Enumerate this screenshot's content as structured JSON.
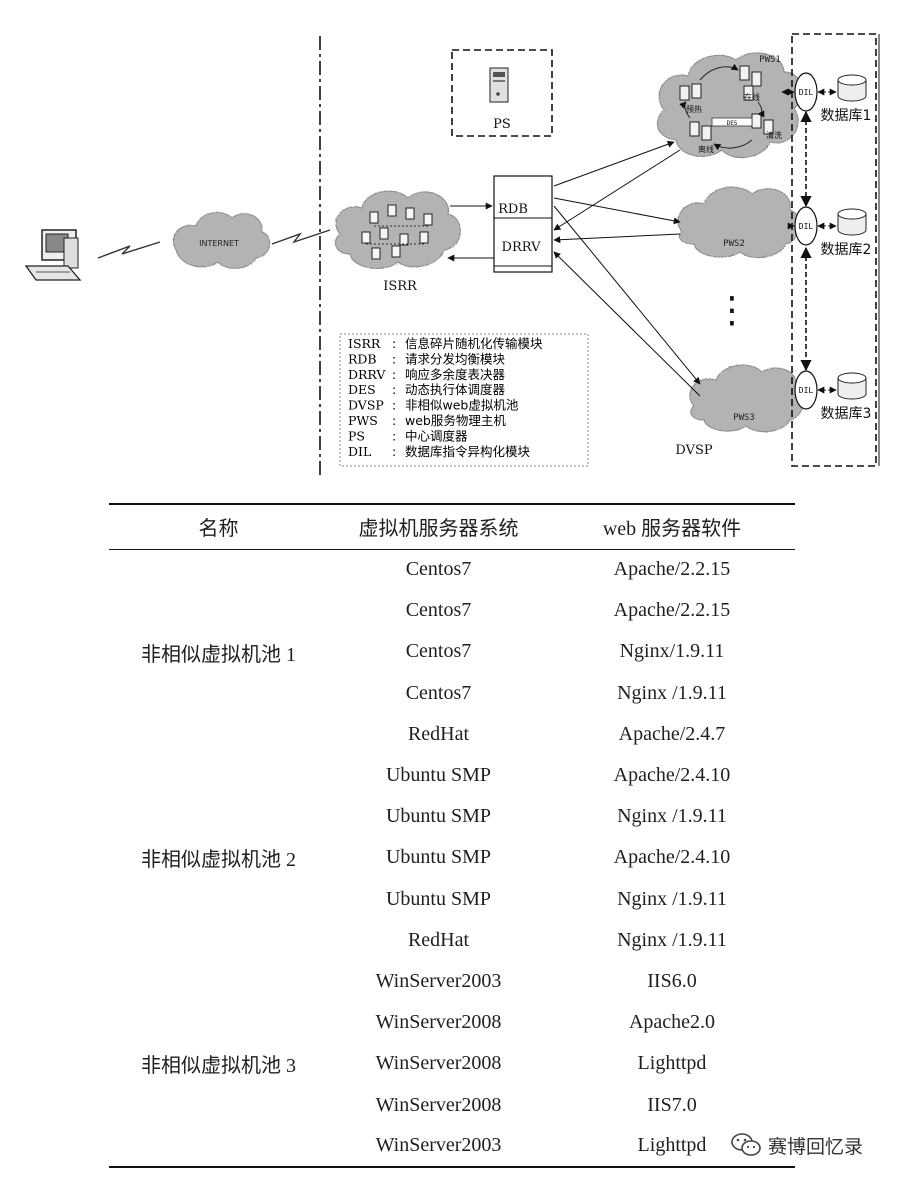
{
  "diagram": {
    "labels": {
      "ps": "PS",
      "pws1": "PWS1",
      "pws2": "PWS2",
      "pws3": "PWS3",
      "internet": "INTERNET",
      "isrr": "ISRR",
      "rdb": "RDB",
      "drrv": "DRRV",
      "dil": "DIL",
      "des": "DES",
      "dvsp": "DVSP",
      "db1": "数据库1",
      "db2": "数据库2",
      "db3": "数据库3",
      "ellipsis": "⋮",
      "pws1_nodes": [
        "预热",
        "在线",
        "离线",
        "清洗"
      ]
    },
    "legend": [
      {
        "abbr": "ISRR",
        "desc": "信息碎片随机化传输模块"
      },
      {
        "abbr": "RDB",
        "desc": "请求分发均衡模块"
      },
      {
        "abbr": "DRRV",
        "desc": "响应多余度表决器"
      },
      {
        "abbr": "DES",
        "desc": "动态执行体调度器"
      },
      {
        "abbr": "DVSP",
        "desc": "非相似web虚拟机池"
      },
      {
        "abbr": "PWS",
        "desc": "web服务物理主机"
      },
      {
        "abbr": "PS",
        "desc": "中心调度器"
      },
      {
        "abbr": "DIL",
        "desc": "数据库指令异构化模块"
      }
    ]
  },
  "table": {
    "headers": [
      "名称",
      "虚拟机服务器系统",
      "web 服务器软件"
    ],
    "pools": [
      {
        "name": "非相似虚拟机池 1",
        "rows": [
          {
            "os": "Centos7",
            "web": "Apache/2.2.15"
          },
          {
            "os": "Centos7",
            "web": "Apache/2.2.15"
          },
          {
            "os": "Centos7",
            "web": "Nginx/1.9.11"
          },
          {
            "os": "Centos7",
            "web": "Nginx /1.9.11"
          },
          {
            "os": "RedHat",
            "web": "Apache/2.4.7"
          }
        ]
      },
      {
        "name": "非相似虚拟机池 2",
        "rows": [
          {
            "os": "Ubuntu SMP",
            "web": "Apache/2.4.10"
          },
          {
            "os": "Ubuntu SMP",
            "web": "Nginx /1.9.11"
          },
          {
            "os": "Ubuntu SMP",
            "web": "Apache/2.4.10"
          },
          {
            "os": "Ubuntu SMP",
            "web": "Nginx /1.9.11"
          },
          {
            "os": "RedHat",
            "web": "Nginx /1.9.11"
          }
        ]
      },
      {
        "name": "非相似虚拟机池 3",
        "rows": [
          {
            "os": "WinServer2003",
            "web": "IIS6.0"
          },
          {
            "os": "WinServer2008",
            "web": "Apache2.0"
          },
          {
            "os": "WinServer2008",
            "web": "Lighttpd"
          },
          {
            "os": "WinServer2008",
            "web": "IIS7.0"
          },
          {
            "os": "WinServer2003",
            "web": "Lighttpd"
          }
        ]
      }
    ]
  },
  "watermark": {
    "text": "赛博回忆录",
    "icon": "wechat-icon"
  },
  "colors": {
    "cloud": "#b3b3b3",
    "line": "#111111"
  }
}
